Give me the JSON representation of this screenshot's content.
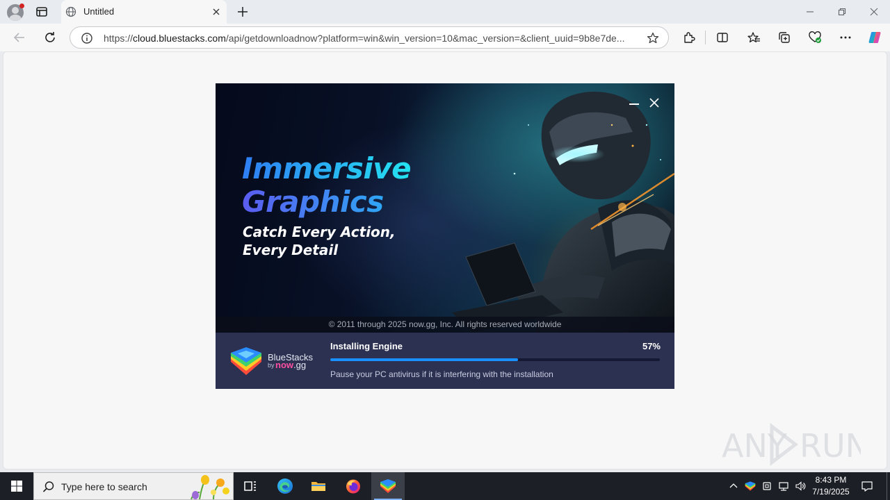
{
  "browser": {
    "tab_title": "Untitled",
    "url_scheme": "https://",
    "url_host": "cloud.bluestacks.com",
    "url_rest": "/api/getdownloadnow?platform=win&win_version=10&mac_version=&client_uuid=9b8e7de...",
    "icons": [
      "profile-icon",
      "tab-actions-icon",
      "globe-icon",
      "close-icon",
      "plus-icon",
      "minimize-icon",
      "restore-icon",
      "back-arrow-icon",
      "reload-icon",
      "info-icon",
      "star-icon",
      "extensions-icon",
      "split-screen-icon",
      "favorites-icon",
      "collections-icon",
      "browser-essentials-icon",
      "more-icon",
      "copilot-icon"
    ]
  },
  "installer": {
    "headline_line1": "Immersive",
    "headline_line2": "Graphics",
    "subline1": "Catch Every Action,",
    "subline2": "Every Detail",
    "copyright": "© 2011 through 2025 now.gg, Inc. All rights reserved worldwide",
    "brand_name": "BlueStacks",
    "brand_by": "by",
    "brand_now": "now",
    "brand_gg": ".gg",
    "status_title": "Installing Engine",
    "progress_text": "57%",
    "progress_value": 57,
    "note": "Pause your PC antivirus if it is interfering with the installation",
    "colors": {
      "panel": "#2c3152",
      "progress": "#1a90ff",
      "accent_pink": "#ff4fa0"
    }
  },
  "watermark": {
    "text": "ANY RUN"
  },
  "taskbar": {
    "search_placeholder": "Type here to search",
    "apps": [
      "task-view-icon",
      "edge-icon",
      "file-explorer-icon",
      "firefox-icon",
      "bluestacks-icon"
    ],
    "clock_time": "8:43 PM",
    "clock_date": "7/19/2025"
  }
}
